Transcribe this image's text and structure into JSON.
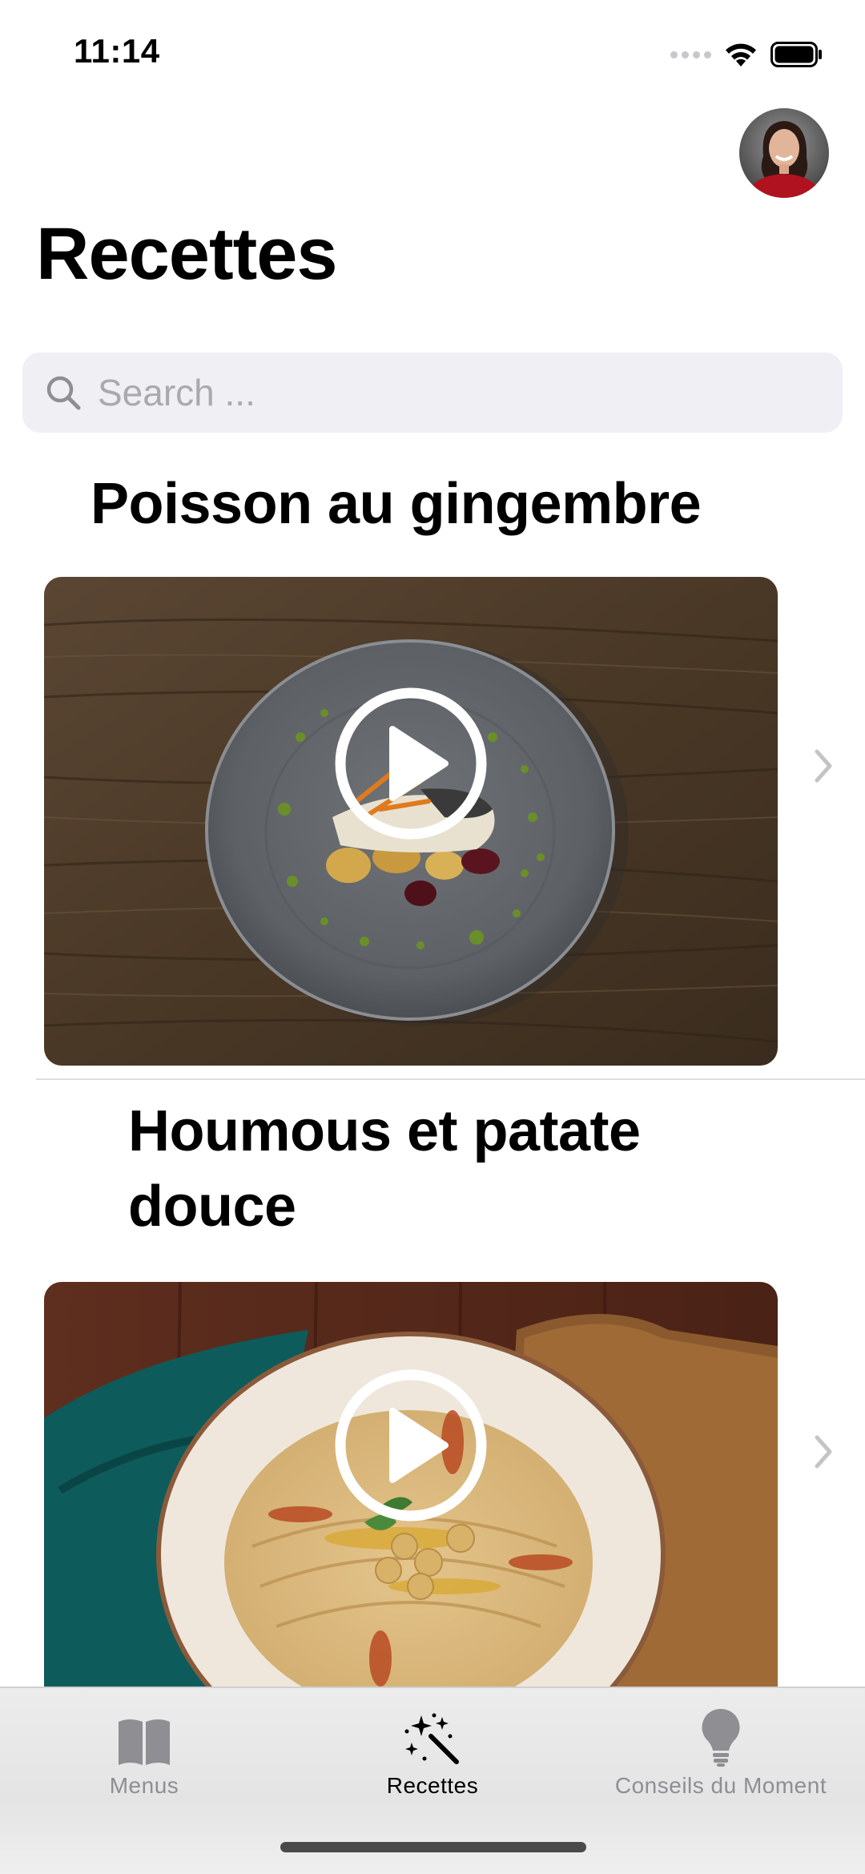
{
  "status_bar": {
    "time": "11:14"
  },
  "header": {
    "title": "Recettes"
  },
  "search": {
    "placeholder": "Search ..."
  },
  "recipes": [
    {
      "title": "Poisson au gingembre"
    },
    {
      "title": "Houmous et patate douce"
    }
  ],
  "tab_bar": {
    "tabs": [
      {
        "label": "Menus",
        "icon": "book-icon",
        "selected": false
      },
      {
        "label": "Recettes",
        "icon": "magic-wand-icon",
        "selected": true
      },
      {
        "label": "Conseils du Moment",
        "icon": "lightbulb-icon",
        "selected": false
      }
    ]
  },
  "colors": {
    "selected_tab": "#000000",
    "unselected_tab": "#8e8e93",
    "search_background": "#efeff4"
  }
}
